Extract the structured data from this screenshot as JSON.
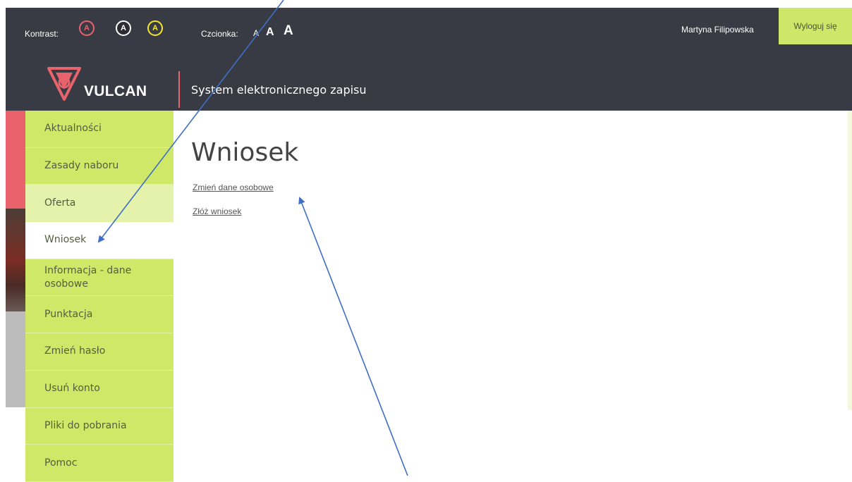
{
  "header": {
    "contrast_label": "Kontrast:",
    "contrast_buttons": [
      "A",
      "A",
      "A"
    ],
    "font_label": "Czcionka:",
    "font_buttons": [
      "A",
      "A",
      "A"
    ],
    "user_name": "Martyna Filipowska",
    "logout_label": "Wyloguj się",
    "logo_text": "VULCAN",
    "system_title": "System elektronicznego zapisu"
  },
  "sidebar": {
    "items": [
      {
        "label": "Aktualności"
      },
      {
        "label": "Zasady naboru"
      },
      {
        "label": "Oferta"
      },
      {
        "label": "Wniosek"
      },
      {
        "label": "Informacja - dane osobowe"
      },
      {
        "label": "Punktacja"
      },
      {
        "label": "Zmień hasło"
      },
      {
        "label": "Usuń konto"
      },
      {
        "label": "Pliki do pobrania"
      },
      {
        "label": "Pomoc"
      }
    ]
  },
  "main": {
    "title": "Wniosek",
    "links": [
      "Zmień dane osobowe",
      "Złóż wniosek"
    ]
  },
  "colors": {
    "header_bg": "#383b43",
    "accent_green": "#d0e868",
    "accent_red": "#e8636c",
    "annotation_arrow": "#3f6fc4"
  }
}
